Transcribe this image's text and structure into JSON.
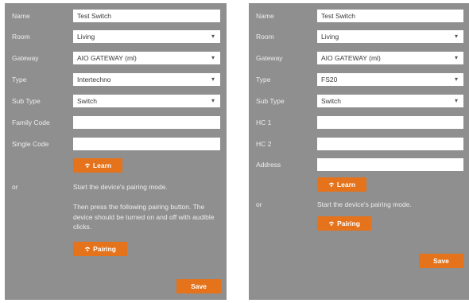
{
  "colors": {
    "panel": "#8f8f8f",
    "accent": "#e4731c",
    "field": "#ffffff"
  },
  "left_panel": {
    "name_label": "Name",
    "name_value": "Test Switch",
    "room_label": "Room",
    "room_value": "Living",
    "gateway_label": "Gateway",
    "gateway_value": "AIO GATEWAY (ml)",
    "type_label": "Type",
    "type_value": "Intertechno",
    "subtype_label": "Sub Type",
    "subtype_value": "Switch",
    "family_code_label": "Family Code",
    "family_code_value": "",
    "single_code_label": "Single Code",
    "single_code_value": "",
    "learn_label": "Learn",
    "or_label": "or",
    "pairing_text_1": "Start the device's pairing mode.",
    "pairing_text_2": "Then press the following pairing button. The device should be turned on and off with audible clicks.",
    "pairing_label": "Pairing",
    "save_label": "Save"
  },
  "right_panel": {
    "name_label": "Name",
    "name_value": "Test Switch",
    "room_label": "Room",
    "room_value": "Living",
    "gateway_label": "Gateway",
    "gateway_value": "AIO GATEWAY (ml)",
    "type_label": "Type",
    "type_value": "FS20",
    "subtype_label": "Sub Type",
    "subtype_value": "Switch",
    "hc1_label": "HC 1",
    "hc1_value": "",
    "hc2_label": "HC 2",
    "hc2_value": "",
    "address_label": "Address",
    "address_value": "",
    "learn_label": "Learn",
    "or_label": "or",
    "pairing_text_1": "Start the device's pairing mode.",
    "pairing_label": "Pairing",
    "save_label": "Save"
  },
  "icons": {
    "learn": "wifi-icon",
    "pairing": "wifi-icon"
  }
}
